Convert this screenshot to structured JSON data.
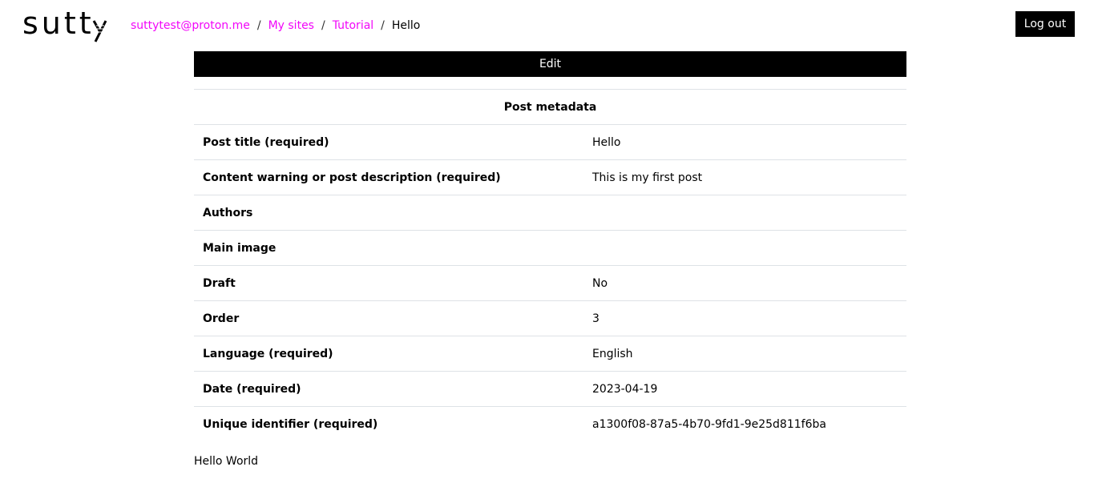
{
  "header": {
    "logo_text": "sutty",
    "breadcrumb": [
      {
        "label": "suttytest@proton.me"
      },
      {
        "label": "My sites"
      },
      {
        "label": "Tutorial"
      }
    ],
    "breadcrumb_current": "Hello",
    "separator": "/",
    "logout_label": "Log out"
  },
  "edit_label": "Edit",
  "metadata": {
    "title": "Post metadata",
    "rows": [
      {
        "key": "Post title (required)",
        "value": "Hello"
      },
      {
        "key": "Content warning or post description (required)",
        "value": "This is my first post"
      },
      {
        "key": "Authors",
        "value": ""
      },
      {
        "key": "Main image",
        "value": ""
      },
      {
        "key": "Draft",
        "value": "No"
      },
      {
        "key": "Order",
        "value": "3"
      },
      {
        "key": "Language (required)",
        "value": "English"
      },
      {
        "key": "Date (required)",
        "value": "2023-04-19"
      },
      {
        "key": "Unique identifier (required)",
        "value": "a1300f08-87a5-4b70-9fd1-9e25d811f6ba"
      }
    ]
  },
  "content": {
    "body": "Hello World"
  },
  "colors": {
    "link": "#f206f9",
    "button_bg": "#000000",
    "divider": "#dee2e6"
  }
}
